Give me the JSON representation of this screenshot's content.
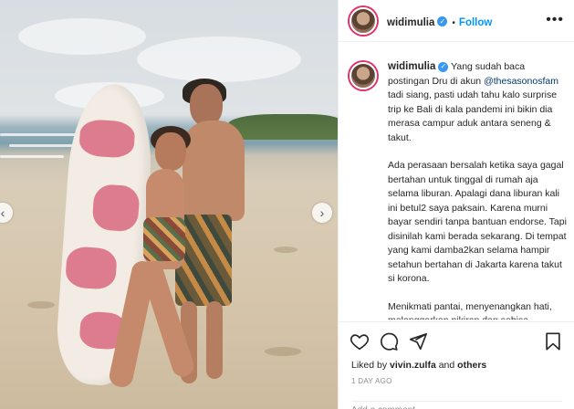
{
  "post": {
    "username": "widimulia",
    "follow_label": "Follow",
    "separator": "•",
    "verified_glyph": "✓",
    "more_glyph": "•••"
  },
  "caption": {
    "username": "widimulia",
    "p1_a": "Yang sudah baca postingan Dru di akun ",
    "mention": "@thesasonosfam",
    "p1_b": " tadi siang, pasti udah tahu kalo surprise trip ke Bali di kala pandemi ini bikin dia merasa campur aduk antara seneng & takut.",
    "p2": "Ada perasaan bersalah ketika saya gagal bertahan untuk tinggal di rumah aja selama liburan. Apalagi dana liburan kali ini betul2 saya paksain. Karena murni bayar sendiri tanpa bantuan endorse. Tapi disinilah kami berada sekarang. Di tempat yang kami damba2kan selama hampir setahun bertahan di Jakarta karena takut si korona.",
    "p3": "Menikmati pantai, menyenangkan hati, melonggarkan pikiran dan sebisa"
  },
  "engagement": {
    "liked_prefix": "Liked by ",
    "liked_user": "vivin.zulfa",
    "liked_suffix": " and ",
    "liked_others": "others",
    "time_ago": "1 DAY AGO",
    "comment_hint": "Add a comment..."
  },
  "carousel": {
    "prev_glyph": "‹",
    "next_glyph": "›"
  },
  "icons": [
    "heart-icon",
    "comment-icon",
    "share-icon",
    "bookmark-icon",
    "verified-icon",
    "more-options-icon"
  ],
  "colors": {
    "accent_blue": "#0095f6",
    "verified_blue": "#3897f0",
    "mention_blue": "#00376b",
    "muted_text": "#8e8e8e"
  }
}
